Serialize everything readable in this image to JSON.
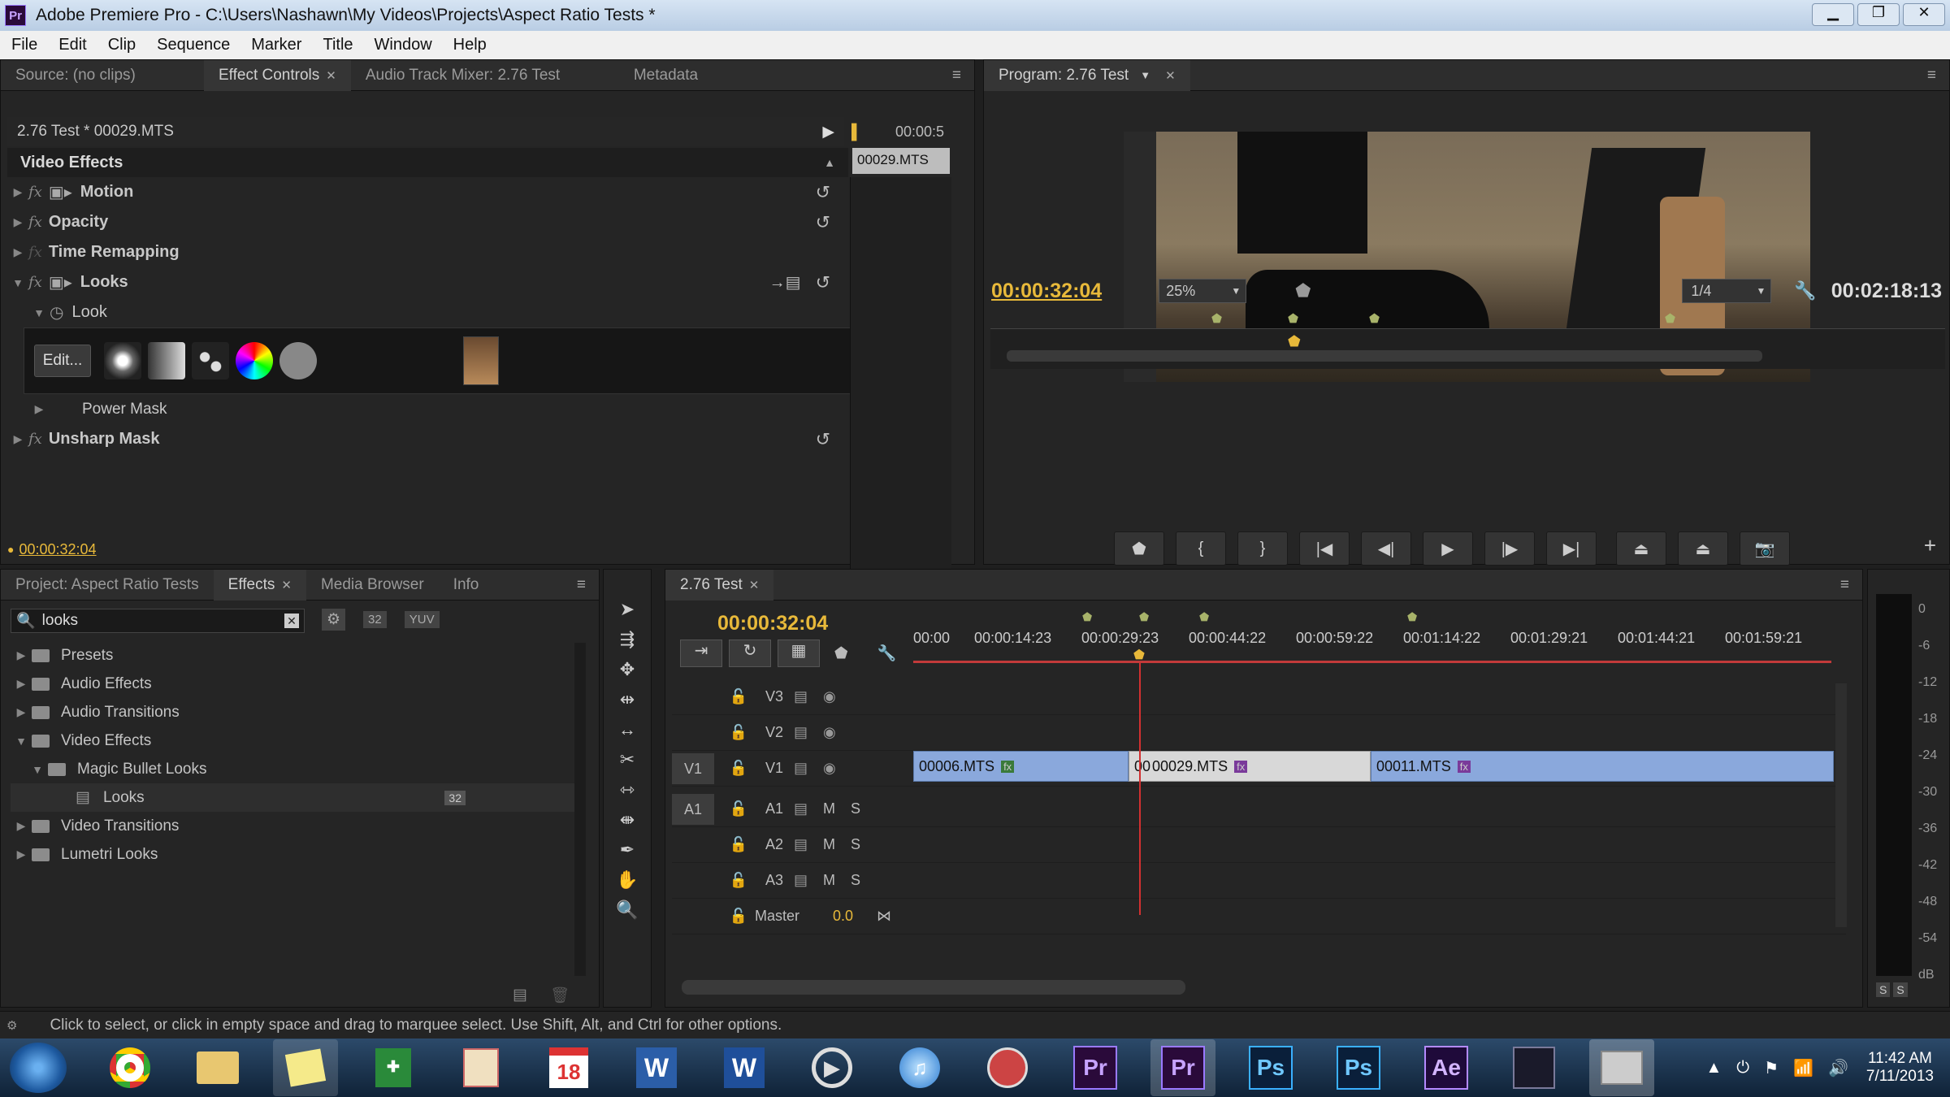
{
  "window": {
    "title": "Adobe Premiere Pro - C:\\Users\\Nashawn\\My Videos\\Projects\\Aspect Ratio Tests *",
    "app_icon": "Pr"
  },
  "menu": [
    "File",
    "Edit",
    "Clip",
    "Sequence",
    "Marker",
    "Title",
    "Window",
    "Help"
  ],
  "source_panel": {
    "tabs": [
      "Source: (no clips)",
      "Effect Controls",
      "Audio Track Mixer: 2.76 Test",
      "Metadata"
    ],
    "clip_path": "2.76 Test * 00029.MTS",
    "time_ruler": "00:00:5",
    "clip_label": "00029.MTS",
    "section": "Video Effects",
    "effects": [
      "Motion",
      "Opacity",
      "Time Remapping",
      "Looks"
    ],
    "look_label": "Look",
    "edit_button": "Edit...",
    "power_mask": "Power Mask",
    "unsharp": "Unsharp Mask",
    "timecode": "00:00:32:04"
  },
  "program": {
    "tab": "Program: 2.76 Test",
    "timecode": "00:00:32:04",
    "zoom": "25%",
    "resolution": "1/4",
    "duration": "00:02:18:13"
  },
  "project_panel": {
    "tabs": [
      "Project: Aspect Ratio Tests",
      "Effects",
      "Media Browser",
      "Info"
    ],
    "search": "looks",
    "tree": [
      {
        "label": "Presets",
        "indent": 0,
        "open": false
      },
      {
        "label": "Audio Effects",
        "indent": 0,
        "open": false
      },
      {
        "label": "Audio Transitions",
        "indent": 0,
        "open": false
      },
      {
        "label": "Video Effects",
        "indent": 0,
        "open": true
      },
      {
        "label": "Magic Bullet Looks",
        "indent": 1,
        "open": true
      },
      {
        "label": "Looks",
        "indent": 2,
        "open": false,
        "badge": "32"
      },
      {
        "label": "Video Transitions",
        "indent": 0,
        "open": false
      },
      {
        "label": "Lumetri Looks",
        "indent": 0,
        "open": false
      }
    ]
  },
  "timeline": {
    "tab": "2.76 Test",
    "timecode": "00:00:32:04",
    "ruler": [
      "00:00",
      "00:00:14:23",
      "00:00:29:23",
      "00:00:44:22",
      "00:00:59:22",
      "00:01:14:22",
      "00:01:29:21",
      "00:01:44:21",
      "00:01:59:21"
    ],
    "video_tracks": [
      "V3",
      "V2",
      "V1"
    ],
    "audio_tracks": [
      "A1",
      "A2",
      "A3"
    ],
    "master": "Master",
    "master_value": "0.0",
    "m": "M",
    "s": "S",
    "v1_target": "V1",
    "a1_target": "A1",
    "clips": [
      "00006.MTS",
      "00029.MTS",
      "00011.MTS"
    ],
    "clip_overlap": "00"
  },
  "meter": {
    "labels": [
      "0",
      "-6",
      "-12",
      "-18",
      "-24",
      "-30",
      "-36",
      "-42",
      "-48",
      "-54",
      "dB"
    ],
    "s": "S"
  },
  "status": "Click to select, or click in empty space and drag to marquee select. Use Shift, Alt, and Ctrl for other options.",
  "taskbar": {
    "time": "11:42 AM",
    "date": "7/11/2013",
    "calendar_day": "18",
    "icons": [
      "Pr",
      "Pr",
      "Ps",
      "Ps",
      "Ae"
    ],
    "word": "W"
  }
}
